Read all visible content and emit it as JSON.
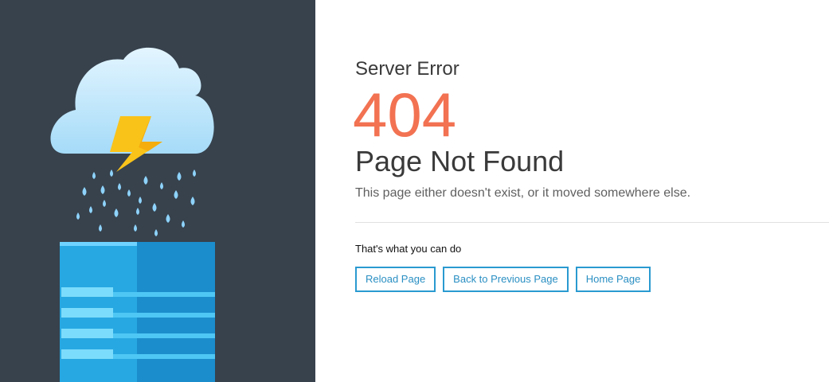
{
  "error": {
    "kicker": "Server Error",
    "code": "404",
    "title": "Page Not Found",
    "message": "This page either doesn't exist, or it moved somewhere else."
  },
  "actions": {
    "label": "That's what you can do",
    "buttons": [
      {
        "label": "Reload Page"
      },
      {
        "label": "Back to Previous Page"
      },
      {
        "label": "Home Page"
      }
    ]
  },
  "colors": {
    "left_panel_bg": "#37424d",
    "error_code": "#f27252",
    "button_border": "#2a9ad0",
    "button_text": "#2a8fc3",
    "cloud": "#bfe6fb",
    "lightning": "#f9c31a",
    "rain": "#8ed3fb",
    "server": "#1f9fdb"
  },
  "icons": {
    "cloud": "cloud-icon",
    "lightning": "lightning-bolt-icon",
    "rain": "raindrop-icon",
    "server": "server-icon"
  }
}
